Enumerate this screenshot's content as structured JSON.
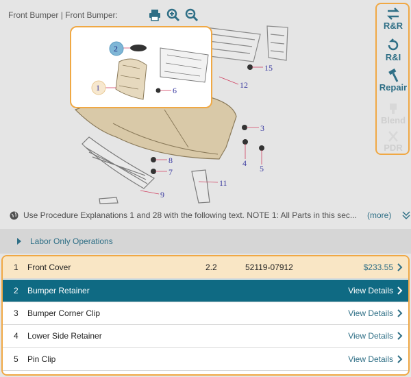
{
  "header": {
    "title": "Front Bumper | Front Bumper:",
    "tools": [
      "print-icon",
      "zoom-in-icon",
      "zoom-out-icon"
    ]
  },
  "diagram": {
    "callouts": [
      "1",
      "2",
      "3",
      "4",
      "5",
      "6",
      "7",
      "8",
      "9",
      "11",
      "12",
      "15"
    ]
  },
  "rail": {
    "items": [
      {
        "label": "R&R",
        "icon": "remove-replace-icon",
        "enabled": true
      },
      {
        "label": "R&I",
        "icon": "remove-install-icon",
        "enabled": true
      },
      {
        "label": "Repair",
        "icon": "hammer-icon",
        "enabled": true
      },
      {
        "label": "Blend",
        "icon": "paint-icon",
        "enabled": false
      },
      {
        "label": "PDR",
        "icon": "pdr-tool-icon",
        "enabled": false
      }
    ]
  },
  "note": {
    "text": "Use Procedure Explanations 1 and 28 with the following text. NOTE 1: All Parts in this sec...",
    "more": "(more)"
  },
  "labor": {
    "label": "Labor Only Operations"
  },
  "parts": [
    {
      "num": "1",
      "name": "Front Cover",
      "hours": "2.2",
      "part_no": "52119-07912",
      "action": "$233.55",
      "state": "highlighted"
    },
    {
      "num": "2",
      "name": "Bumper Retainer",
      "hours": "",
      "part_no": "",
      "action": "View Details",
      "state": "selected"
    },
    {
      "num": "3",
      "name": "Bumper Corner Clip",
      "hours": "",
      "part_no": "",
      "action": "View Details",
      "state": "normal"
    },
    {
      "num": "4",
      "name": "Lower Side Retainer",
      "hours": "",
      "part_no": "",
      "action": "View Details",
      "state": "normal"
    },
    {
      "num": "5",
      "name": "Pin Clip",
      "hours": "",
      "part_no": "",
      "action": "View Details",
      "state": "normal"
    }
  ],
  "colors": {
    "accent": "#f0a844",
    "brand": "#0f6a83",
    "link": "#2f6f86"
  }
}
